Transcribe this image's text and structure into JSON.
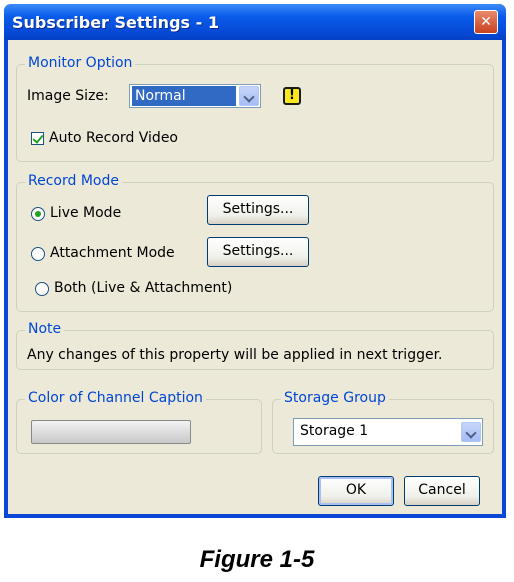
{
  "window": {
    "title": "Subscriber Settings - 1",
    "close_glyph": "✕"
  },
  "monitor_option": {
    "legend": "Monitor Option",
    "image_size_label": "Image Size:",
    "image_size_value": "Normal",
    "warning_glyph": "!",
    "auto_record_label": "Auto Record Video",
    "auto_record_checked": true
  },
  "record_mode": {
    "legend": "Record Mode",
    "options": [
      {
        "label": "Live Mode",
        "checked": true
      },
      {
        "label": "Attachment Mode",
        "checked": false
      },
      {
        "label": "Both (Live & Attachment)",
        "checked": false
      }
    ],
    "settings_label": "Settings..."
  },
  "note": {
    "legend": "Note",
    "text": "Any changes of this property will be applied in next trigger."
  },
  "color_caption": {
    "legend": "Color of Channel Caption"
  },
  "storage_group": {
    "legend": "Storage Group",
    "value": "Storage 1"
  },
  "buttons": {
    "ok": "OK",
    "cancel": "Cancel"
  },
  "figure_caption": "Figure 1-5",
  "colors": {
    "titlebar": "#0a5bea",
    "dialog_bg": "#ece9d8",
    "legend_text": "#0046d5",
    "selection": "#316ac5",
    "check_green": "#21a121",
    "warning_yellow": "#f8e71c"
  },
  "icons": [
    "close-icon",
    "warning-icon",
    "chevron-down-icon"
  ]
}
